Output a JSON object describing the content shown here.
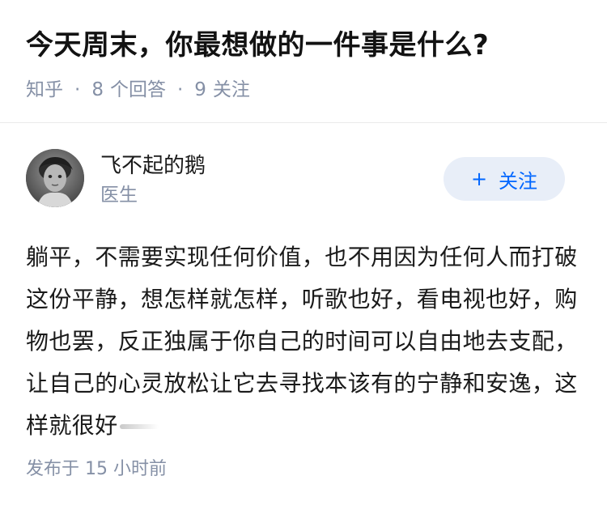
{
  "question": {
    "title": "今天周末，你最想做的一件事是什么?",
    "source": "知乎",
    "answer_count": "8",
    "answer_label": "个回答",
    "follower_count": "9",
    "follower_label": "关注"
  },
  "answer": {
    "author_name": "飞不起的鹅",
    "author_badge": "医生",
    "follow_button": {
      "icon": "plus-icon",
      "plus": "+",
      "label": "关注",
      "color": "#0066ff",
      "background": "#e8eef8"
    },
    "content": "躺平，不需要实现任何价值，也不用因为任何人而打破这份平静，想怎样就怎样，听歌也好，看电视也好，购物也罢，反正独属于你自己的时间可以自由地去支配，让自己的心灵放松让它去寻找本该有的宁静和安逸，这样就很好",
    "publish_time": "发布于 15 小时前"
  }
}
